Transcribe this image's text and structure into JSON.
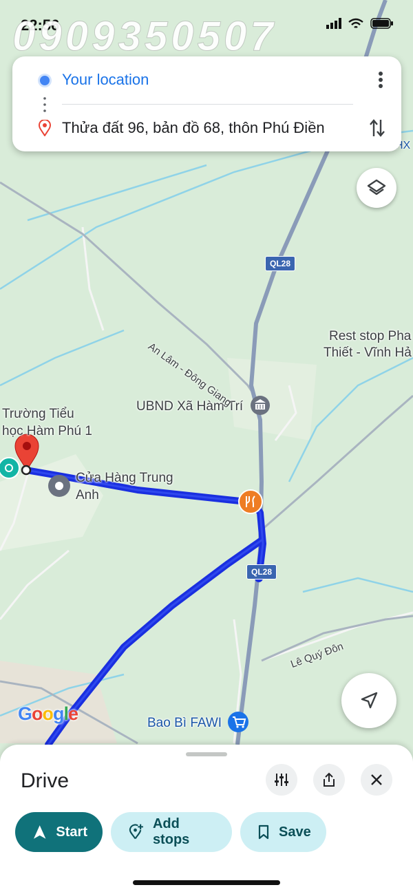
{
  "status_bar": {
    "time": "22:56",
    "watermark": "0909350507"
  },
  "directions": {
    "origin": "Your location",
    "destination": "Thửa đất 96, bản đồ 68, thôn Phú Điền"
  },
  "map": {
    "labels": {
      "rest_stop_line1": "Rest stop Pha",
      "rest_stop_line2": "Thiết - Vĩnh Hả",
      "ubnd": "UBND Xã Hàm Trí",
      "school_line1": "Trường Tiểu",
      "school_line2": "học Hàm Phú 1",
      "shop_line1": "Cửa Hàng Trung",
      "shop_line2": "Anh",
      "bao_bi": "Bao Bì FAWI",
      "road_an_lam": "An Lâm - Đông Giang",
      "road_le_quy_don": "Lê Quý Đôn",
      "shield_top": "QL28",
      "shield_bottom": "QL28",
      "edge_label": "HX"
    },
    "logo": {
      "g1": "G",
      "o1": "o",
      "o2": "o",
      "g2": "g",
      "l": "l",
      "e": "e"
    },
    "colors": {
      "route": "#1a2fe0",
      "land": "#d9ecd9",
      "water_lines": "#8fd3e8",
      "main_road": "#8a9bb8"
    }
  },
  "bottom_sheet": {
    "title": "Drive",
    "actions": {
      "start": "Start",
      "add_stops": "Add stops",
      "save": "Save"
    }
  }
}
